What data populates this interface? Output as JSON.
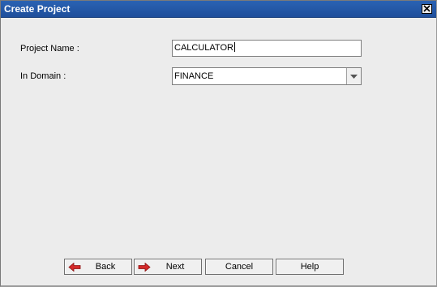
{
  "window": {
    "title": "Create Project"
  },
  "form": {
    "project_name_label": "Project Name :",
    "project_name_value": "CALCULATOR",
    "domain_label": "In Domain :",
    "domain_value": "FINANCE"
  },
  "buttons": {
    "back_label": "Back",
    "next_label": "Next",
    "cancel_label": "Cancel",
    "help_label": "Help"
  },
  "icons": {
    "close": "close-icon",
    "dropdown": "chevron-down-icon",
    "back": "arrow-left-icon",
    "next": "arrow-right-icon"
  },
  "colors": {
    "titlebar": "#1f4f9b",
    "arrow_icon": "#d42a2a"
  }
}
